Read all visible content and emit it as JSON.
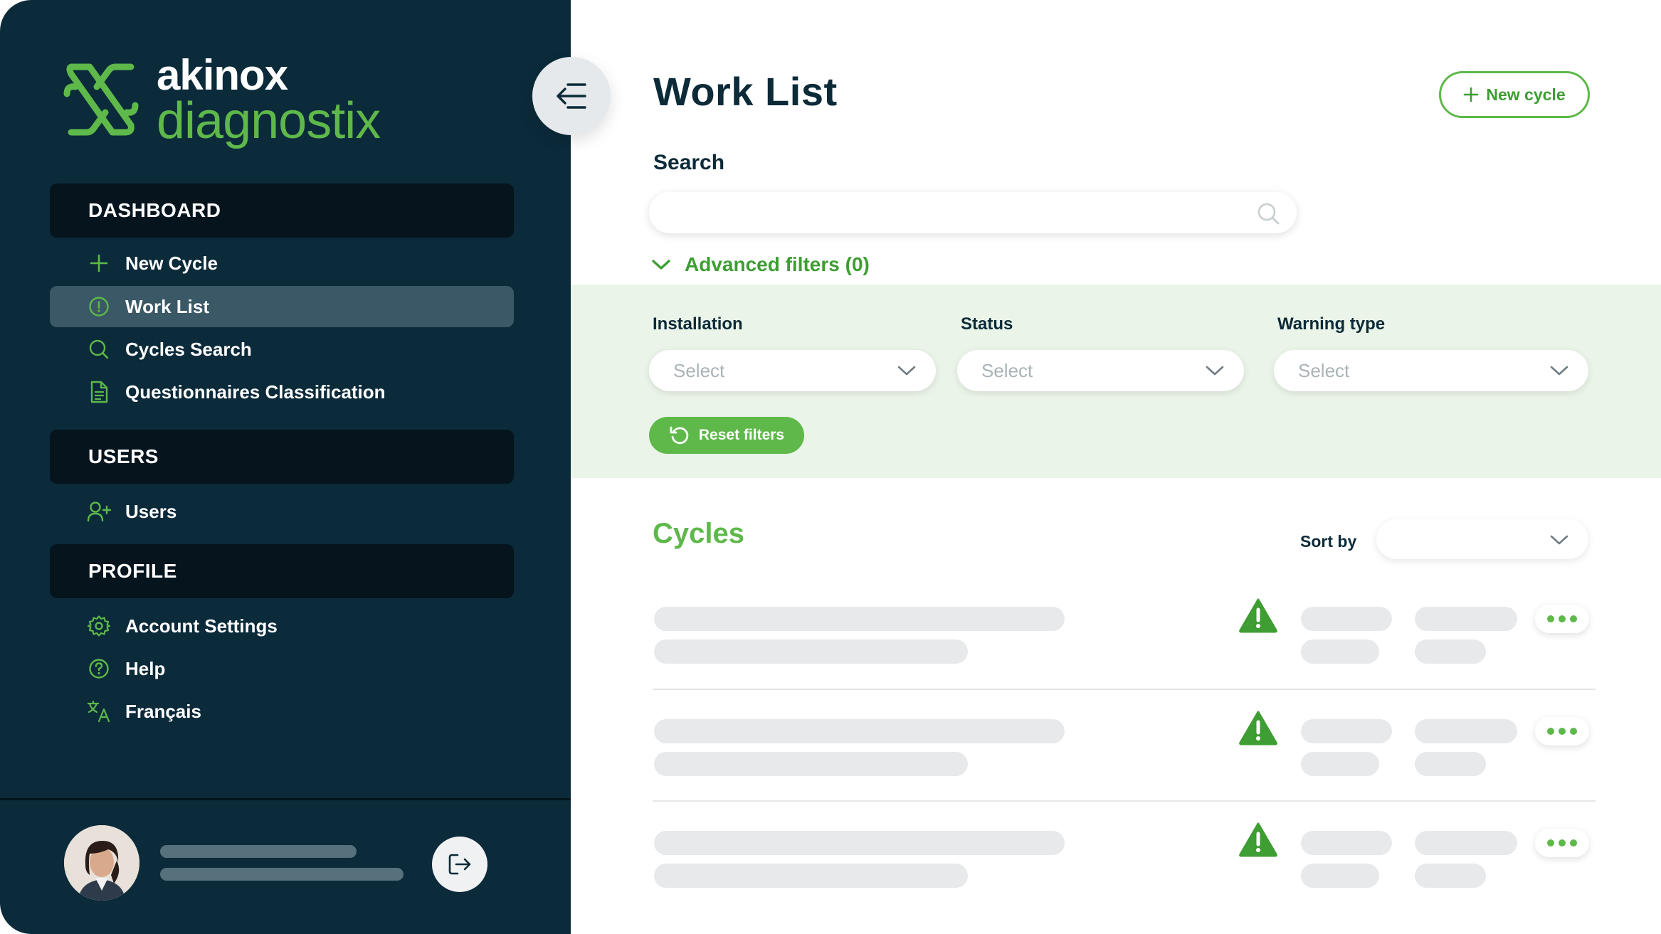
{
  "brand": {
    "name_line1": "akinox",
    "name_line2": "diagnostix",
    "colors": {
      "sidebar": "#0b2a3a",
      "accent": "#5eb84a",
      "header_dark": "#05141d",
      "active": "#3b5866"
    }
  },
  "sidebar": {
    "sections": [
      {
        "title": "DASHBOARD",
        "items": [
          {
            "label": "New Cycle",
            "icon": "plus-icon",
            "active": false
          },
          {
            "label": "Work List",
            "icon": "alert-circle-icon",
            "active": true
          },
          {
            "label": "Cycles Search",
            "icon": "search-icon",
            "active": false
          },
          {
            "label": "Questionnaires Classification",
            "icon": "document-icon",
            "active": false
          }
        ]
      },
      {
        "title": "USERS",
        "items": [
          {
            "label": "Users",
            "icon": "user-plus-icon",
            "active": false
          }
        ]
      },
      {
        "title": "PROFILE",
        "items": [
          {
            "label": "Account Settings",
            "icon": "gear-icon",
            "active": false
          },
          {
            "label": "Help",
            "icon": "help-circle-icon",
            "active": false
          },
          {
            "label": "Français",
            "icon": "translate-icon",
            "active": false
          }
        ]
      }
    ],
    "collapse_icon": "collapse-menu-icon",
    "logout_icon": "logout-icon"
  },
  "main": {
    "title": "Work List",
    "new_cycle_label": "New cycle",
    "search": {
      "label": "Search",
      "value": "",
      "placeholder": ""
    },
    "advanced_filters_label": "Advanced filters (0)",
    "filters": [
      {
        "label": "Installation",
        "value": "Select"
      },
      {
        "label": "Status",
        "value": "Select"
      },
      {
        "label": "Warning type",
        "value": "Select"
      }
    ],
    "reset_filters_label": "Reset filters",
    "cycles_title": "Cycles",
    "sort_by_label": "Sort by",
    "sort_by_value": "",
    "rows": [
      {
        "warning_icon": "warning-triangle-icon"
      },
      {
        "warning_icon": "warning-triangle-icon"
      },
      {
        "warning_icon": "warning-triangle-icon"
      }
    ]
  }
}
